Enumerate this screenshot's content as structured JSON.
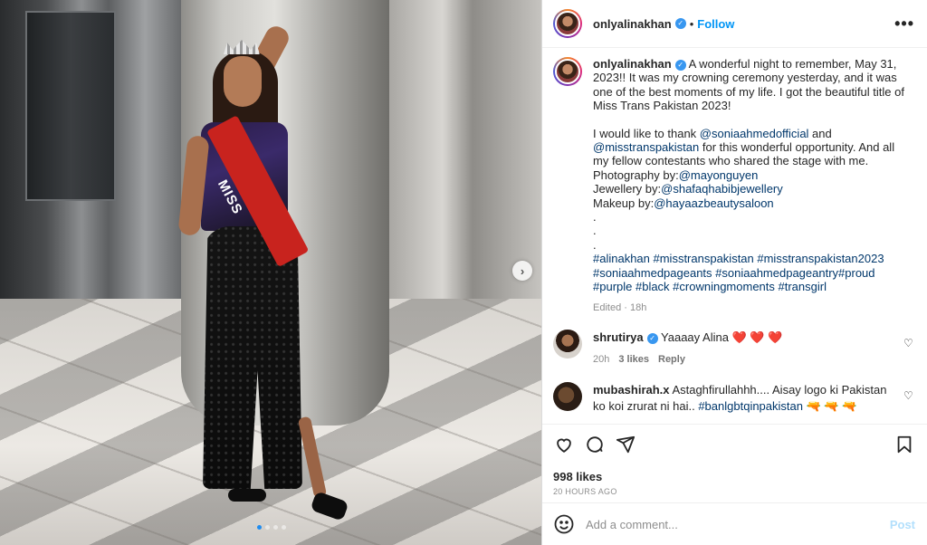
{
  "post": {
    "username": "onlyalinakhan",
    "follow_label": "Follow",
    "separator": "•",
    "more_label": "•••"
  },
  "caption": {
    "username": "onlyalinakhan",
    "line1": "A wonderful night to remember, May 31, 2023!! It was my crowning ceremony yesterday, and it was one of the best moments of my life. I got the beautiful title of Miss Trans Pakistan 2023!",
    "thanks_prefix": "I would like to thank ",
    "mention1": "@soniaahmedofficial",
    "thanks_and": " and",
    "mention2": "@misstranspakistan",
    "thanks_rest": " for this wonderful opportunity. And all my fellow contestants who shared the stage with me.",
    "photo_label": "Photography by:",
    "photo_mention": "@mayonguyen",
    "jewel_label": "Jewellery by:",
    "jewel_mention": "@shafaqhabibjewellery",
    "makeup_label": "Makeup by:",
    "makeup_mention": "@hayaazbeautysaloon",
    "dot": ".",
    "hashtags": "#alinakhan #misstranspakistan #misstranspakistan2023 #soniaahmedpageants #soniaahmedpageantry#proud #purple #black #crowningmoments #transgirl",
    "meta": "Edited · 18h"
  },
  "comments": [
    {
      "username": "shrutirya",
      "text": "Yaaaay Alina ",
      "emoji": "❤️ ❤️ ❤️",
      "time": "20h",
      "likes": "3 likes",
      "reply": "Reply"
    },
    {
      "username": "mubashirah.x",
      "text": "Astaghfirullahhh.... Aisay logo ki Pakistan ko koi zrurat ni hai.. ",
      "hashtag": "#banlgbtqinpakistan",
      "emoji": " 🔫 🔫 🔫"
    }
  ],
  "stats": {
    "likes": "998 likes",
    "time": "20 HOURS AGO"
  },
  "composer": {
    "placeholder": "Add a comment...",
    "post_label": "Post"
  },
  "media": {
    "sash_text": "MISS",
    "next_label": "›",
    "carousel_total": 4,
    "carousel_active": 1
  },
  "colors": {
    "link": "#0095f6",
    "mention": "#00376b",
    "verified": "#3897f0",
    "post_disabled": "#b2dffc"
  }
}
